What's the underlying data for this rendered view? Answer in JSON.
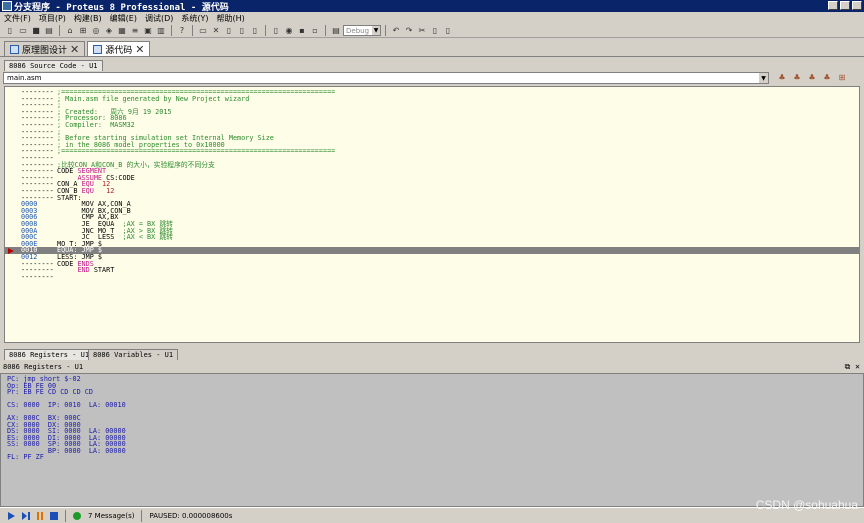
{
  "window": {
    "title": "分支程序 - Proteus 8 Professional - 源代码"
  },
  "menu": [
    "文件(F)",
    "项目(P)",
    "构建(B)",
    "编辑(E)",
    "调试(D)",
    "系统(Y)",
    "帮助(H)"
  ],
  "toolbar": {
    "config_combo": "Debug"
  },
  "doc_tabs": [
    {
      "label": "原理图设计",
      "active": false
    },
    {
      "label": "源代码",
      "active": true
    }
  ],
  "source_pane": {
    "tab": "8086 Source Code - U1",
    "file": "main.asm"
  },
  "code": [
    {
      "addr": "--------",
      "text": ";===================================================================",
      "kind": "comment"
    },
    {
      "addr": "--------",
      "text": "; Main.asm file generated by New Project wizard",
      "kind": "comment"
    },
    {
      "addr": "--------",
      "text": ";",
      "kind": "comment"
    },
    {
      "addr": "--------",
      "text": "; Created:   周六 9月 19 2015",
      "kind": "comment"
    },
    {
      "addr": "--------",
      "text": "; Processor: 8086",
      "kind": "comment"
    },
    {
      "addr": "--------",
      "text": "; Compiler:  MASM32",
      "kind": "comment"
    },
    {
      "addr": "--------",
      "text": ";",
      "kind": "comment"
    },
    {
      "addr": "--------",
      "text": "; Before starting simulation set Internal Memory Size",
      "kind": "comment"
    },
    {
      "addr": "--------",
      "text": "; in the 8086 model properties to 0x10000",
      "kind": "comment"
    },
    {
      "addr": "--------",
      "text": ";===================================================================",
      "kind": "comment"
    },
    {
      "addr": "--------",
      "text": "",
      "kind": "plain"
    },
    {
      "addr": "--------",
      "text": ";比较CON_A和CON_B 的大小，实验程序的不同分支",
      "kind": "comment"
    },
    {
      "addr": "--------",
      "text": "CODE SEGMENT",
      "kind": "plain"
    },
    {
      "addr": "--------",
      "text": "     ASSUME CS:CODE",
      "kind": "plain"
    },
    {
      "addr": "--------",
      "text": "CON_A EQU  12",
      "kind": "plain"
    },
    {
      "addr": "--------",
      "text": "CON_B EQU   12",
      "kind": "plain"
    },
    {
      "addr": "--------",
      "text": "START:",
      "kind": "plain"
    },
    {
      "addr": "0000",
      "text": "      MOV AX,CON_A",
      "kind": "plain"
    },
    {
      "addr": "0003",
      "text": "      MOV BX,CON_B",
      "kind": "plain"
    },
    {
      "addr": "0006",
      "text": "      CMP AX,BX",
      "kind": "plain"
    },
    {
      "addr": "0008",
      "text": "      JE  EQUA  ;AX = BX 跳转",
      "kind": "plain"
    },
    {
      "addr": "000A",
      "text": "      JNC MO_T  ;AX > BX 跳转",
      "kind": "plain"
    },
    {
      "addr": "000C",
      "text": "      JC  LESS  ;AX < BX 跳转",
      "kind": "plain"
    },
    {
      "addr": "000E",
      "text": "MO_T: JMP $",
      "kind": "plain"
    },
    {
      "addr": "0010",
      "text": "EQUA: JMP $",
      "kind": "highlight"
    },
    {
      "addr": "0012",
      "text": "LESS: JMP $",
      "kind": "plain"
    },
    {
      "addr": "--------",
      "text": "CODE ENDS",
      "kind": "plain"
    },
    {
      "addr": "--------",
      "text": "     END START",
      "kind": "plain"
    },
    {
      "addr": "--------",
      "text": "",
      "kind": "plain"
    }
  ],
  "bottom_tabs": [
    "8086 Registers - U1",
    "8086 Variables - U1"
  ],
  "registers_title": "8086 Registers - U1",
  "registers": [
    "PC: jmp short $-02",
    "Op: EB FE 00",
    "Pr: EB FE CD CD CD CD",
    "",
    "CS: 0000  IP: 0010  LA: 00010",
    "",
    "AX: 000C  BX: 000C",
    "CX: 0000  DX: 0000",
    "DS: 0000  SI: 0000  LA: 00000",
    "ES: 0000  DI: 0000  LA: 00000",
    "SS: 0000  SP: 0000  LA: 00000",
    "          BP: 0000  LA: 00000",
    "FL: PF ZF"
  ],
  "status": {
    "messages": "7 Message(s)",
    "state": "PAUSED: 0.000008600s"
  },
  "watermark": "CSDN @sohuahua"
}
